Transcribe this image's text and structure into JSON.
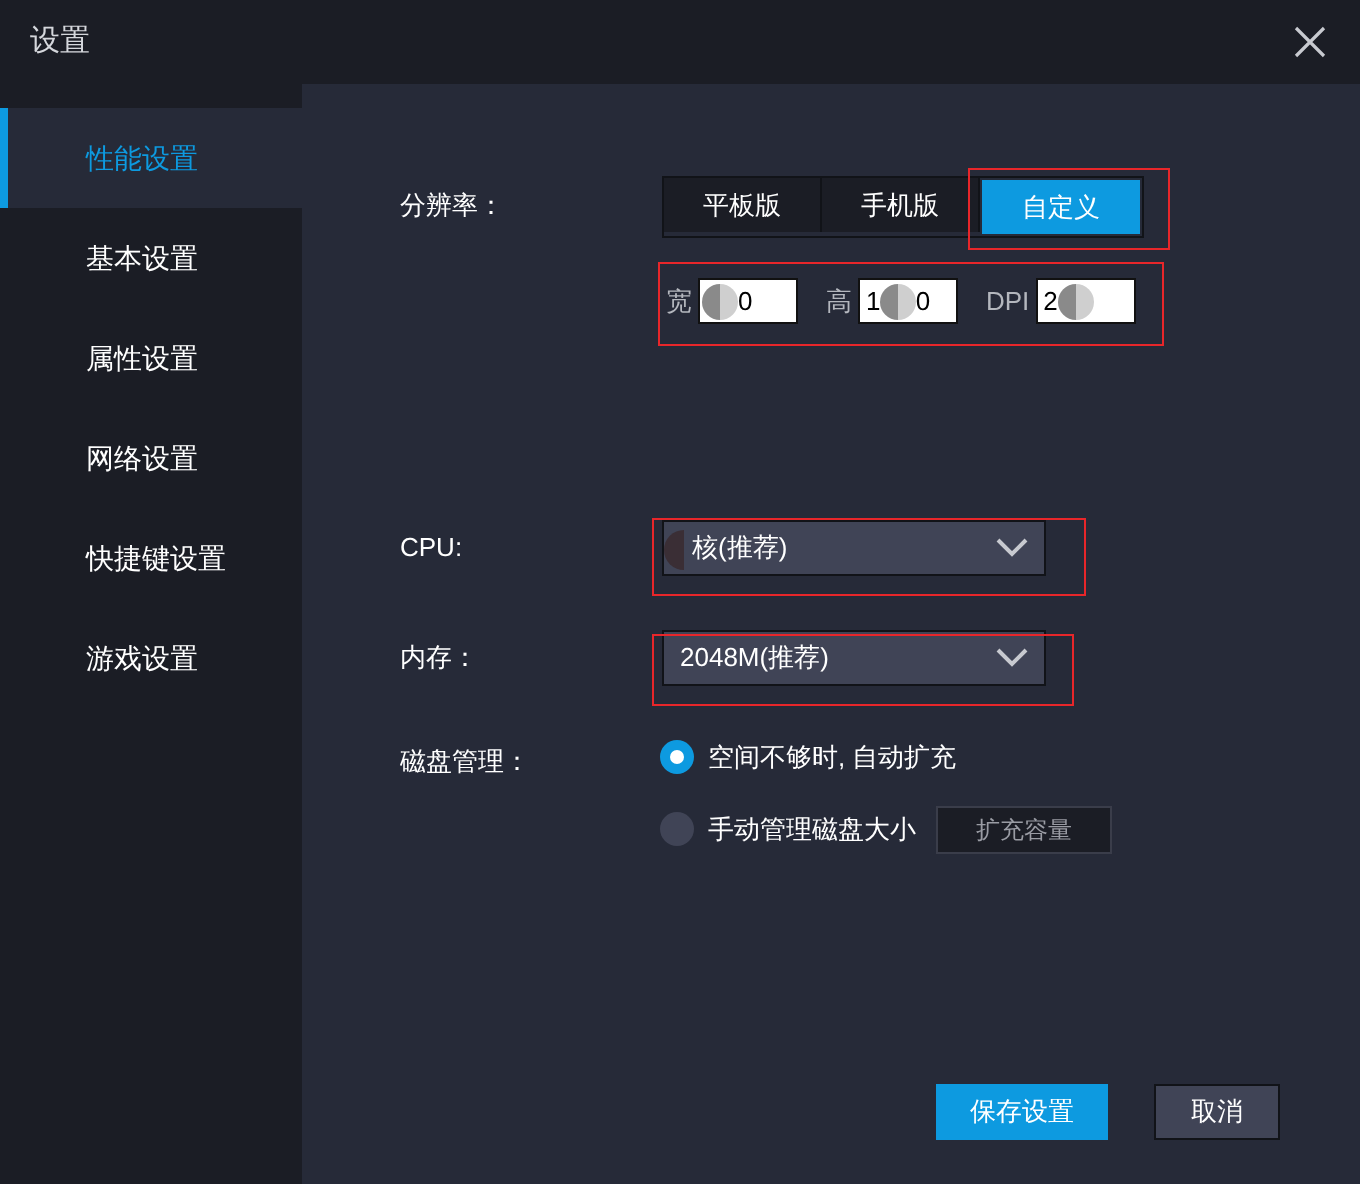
{
  "window": {
    "title": "设置"
  },
  "sidebar": {
    "items": [
      {
        "label": "性能设置",
        "selected": true
      },
      {
        "label": "基本设置",
        "selected": false
      },
      {
        "label": "属性设置",
        "selected": false
      },
      {
        "label": "网络设置",
        "selected": false
      },
      {
        "label": "快捷键设置",
        "selected": false
      },
      {
        "label": "游戏设置",
        "selected": false
      }
    ]
  },
  "resolution": {
    "label": "分辨率：",
    "options": [
      {
        "label": "平板版",
        "selected": false
      },
      {
        "label": "手机版",
        "selected": false
      },
      {
        "label": "自定义",
        "selected": true
      }
    ],
    "fields": [
      {
        "label": "宽",
        "value": "0"
      },
      {
        "label": "高",
        "value": "1 0"
      },
      {
        "label": "DPI",
        "value": "2"
      }
    ]
  },
  "cpu": {
    "label": "CPU:",
    "value": "核(推荐)"
  },
  "memory": {
    "label": "内存：",
    "value": "2048M(推荐)"
  },
  "disk": {
    "label": "磁盘管理：",
    "options": [
      {
        "label": "空间不够时, 自动扩充",
        "selected": true
      },
      {
        "label": "手动管理磁盘大小",
        "selected": false
      }
    ],
    "expand_button": "扩充容量"
  },
  "buttons": [
    {
      "label": "保存设置",
      "kind": "primary"
    },
    {
      "label": "取消",
      "kind": "secondary"
    }
  ]
}
